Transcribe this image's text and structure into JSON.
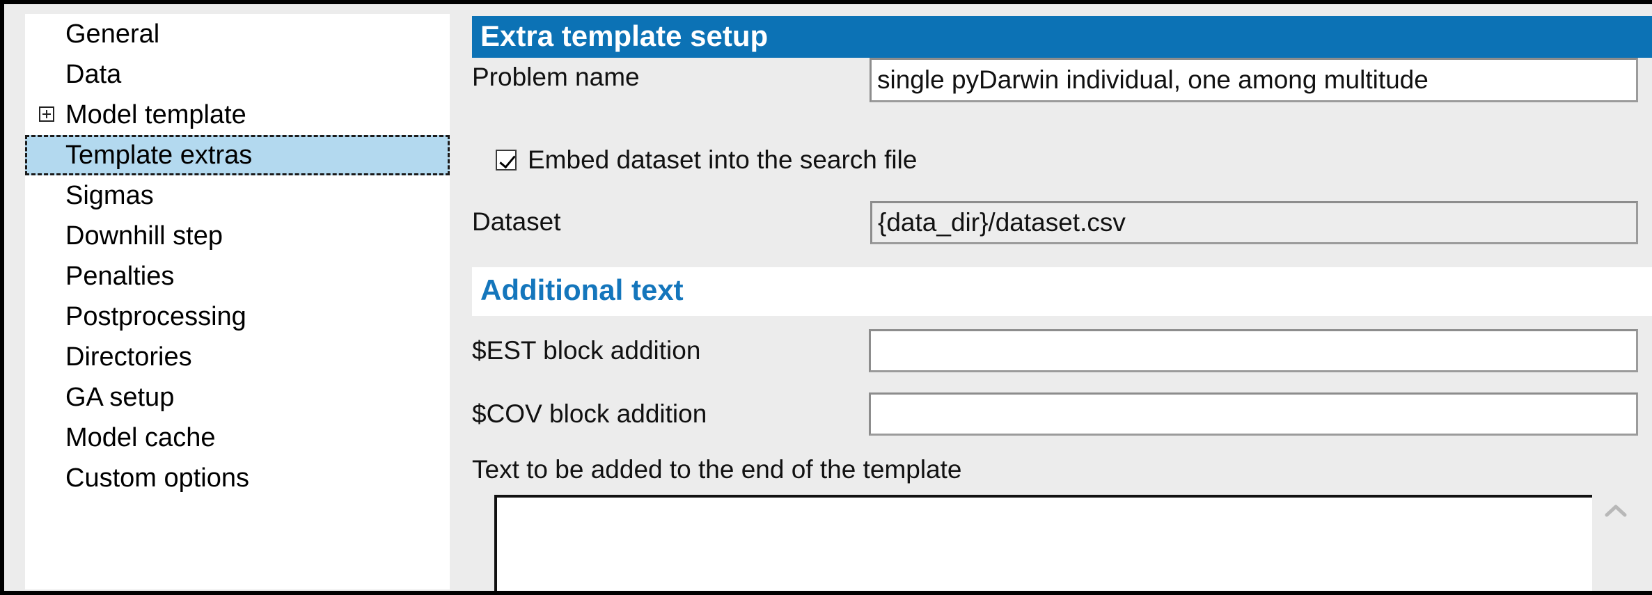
{
  "sidebar": {
    "items": [
      {
        "label": "General",
        "expandable": false,
        "selected": false
      },
      {
        "label": "Data",
        "expandable": false,
        "selected": false
      },
      {
        "label": "Model template",
        "expandable": true,
        "selected": false
      },
      {
        "label": "Template extras",
        "expandable": false,
        "selected": true
      },
      {
        "label": "Sigmas",
        "expandable": false,
        "selected": false
      },
      {
        "label": "Downhill step",
        "expandable": false,
        "selected": false
      },
      {
        "label": "Penalties",
        "expandable": false,
        "selected": false
      },
      {
        "label": "Postprocessing",
        "expandable": false,
        "selected": false
      },
      {
        "label": "Directories",
        "expandable": false,
        "selected": false
      },
      {
        "label": "GA setup",
        "expandable": false,
        "selected": false
      },
      {
        "label": "Model cache",
        "expandable": false,
        "selected": false
      },
      {
        "label": "Custom options",
        "expandable": false,
        "selected": false
      }
    ]
  },
  "main": {
    "section_extra_template": {
      "title": "Extra template setup",
      "problem_name": {
        "label": "Problem name",
        "value": "single pyDarwin individual, one among multitude"
      },
      "embed_dataset": {
        "label": "Embed dataset into the search file",
        "checked": true
      },
      "dataset": {
        "label": "Dataset",
        "value": "{data_dir}/dataset.csv"
      }
    },
    "section_additional_text": {
      "title": "Additional text",
      "est_block": {
        "label": "$EST block addition",
        "value": ""
      },
      "cov_block": {
        "label": "$COV block addition",
        "value": ""
      },
      "end_of_template": {
        "label": "Text to be added to the end of the template",
        "value": ""
      },
      "scroll_up_icon": "chevron-up-icon"
    }
  },
  "colors": {
    "header_blue": "#0c72b5",
    "accent_blue_text": "#1476bc",
    "selection_blue": "#b3d9ef",
    "panel_gray": "#ececec"
  }
}
